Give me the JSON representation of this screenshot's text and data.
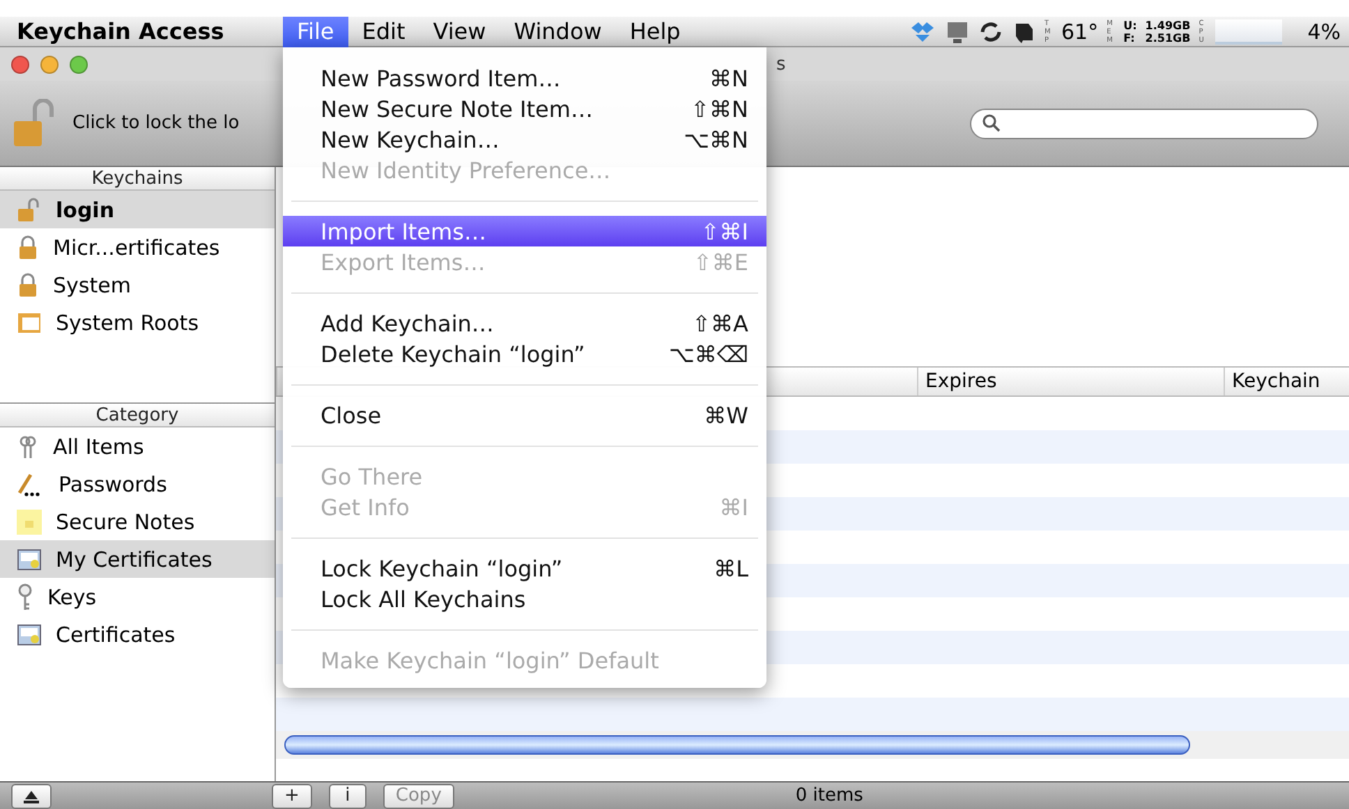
{
  "menu_bar": {
    "app": "Keychain Access",
    "menus": [
      {
        "label": "File",
        "selected": true
      },
      {
        "label": "Edit",
        "selected": false
      },
      {
        "label": "View",
        "selected": false
      },
      {
        "label": "Window",
        "selected": false
      },
      {
        "label": "Help",
        "selected": false
      }
    ],
    "status": {
      "temp_label": "TMP",
      "temp": "61°",
      "mem_label": "MEM",
      "mem_used_label": "U:",
      "mem_used": "1.49GB",
      "mem_free_label": "F:",
      "mem_free": "2.51GB",
      "cpu_label": "CPU",
      "cpu": "4%"
    }
  },
  "window": {
    "title": "s",
    "lock_hint": "Click to lock the lo"
  },
  "sidebar": {
    "keychains_header": "Keychains",
    "keychains": [
      {
        "label": "login",
        "selected": true
      },
      {
        "label": "Micr...ertificates",
        "selected": false
      },
      {
        "label": "System",
        "selected": false
      },
      {
        "label": "System Roots",
        "selected": false
      }
    ],
    "category_header": "Category",
    "categories": [
      {
        "label": "All Items",
        "selected": false
      },
      {
        "label": "Passwords",
        "selected": false
      },
      {
        "label": "Secure Notes",
        "selected": false
      },
      {
        "label": "My Certificates",
        "selected": true
      },
      {
        "label": "Keys",
        "selected": false
      },
      {
        "label": "Certificates",
        "selected": false
      }
    ]
  },
  "table": {
    "columns": [
      "Expires",
      "Keychain"
    ]
  },
  "file_menu": [
    {
      "kind": "item",
      "label": "New Password Item…",
      "shortcut": "⌘N",
      "disabled": false,
      "selected": false
    },
    {
      "kind": "item",
      "label": "New Secure Note Item…",
      "shortcut": "⇧⌘N",
      "disabled": false,
      "selected": false
    },
    {
      "kind": "item",
      "label": "New Keychain…",
      "shortcut": "⌥⌘N",
      "disabled": false,
      "selected": false
    },
    {
      "kind": "item",
      "label": "New Identity Preference…",
      "disabled": true,
      "selected": false
    },
    {
      "kind": "separator"
    },
    {
      "kind": "item",
      "label": "Import Items…",
      "shortcut": "⇧⌘I",
      "disabled": false,
      "selected": true
    },
    {
      "kind": "item",
      "label": "Export Items…",
      "shortcut": "⇧⌘E",
      "disabled": true,
      "selected": false
    },
    {
      "kind": "separator"
    },
    {
      "kind": "item",
      "label": "Add Keychain…",
      "shortcut": "⇧⌘A",
      "disabled": false,
      "selected": false
    },
    {
      "kind": "item",
      "label": "Delete Keychain “login”",
      "shortcut": "⌥⌘⌫",
      "disabled": false,
      "selected": false
    },
    {
      "kind": "separator"
    },
    {
      "kind": "item",
      "label": "Close",
      "shortcut": "⌘W",
      "disabled": false,
      "selected": false
    },
    {
      "kind": "separator"
    },
    {
      "kind": "item",
      "label": "Go There",
      "disabled": true,
      "selected": false
    },
    {
      "kind": "item",
      "label": "Get Info",
      "shortcut": "⌘I",
      "disabled": true,
      "selected": false
    },
    {
      "kind": "separator"
    },
    {
      "kind": "item",
      "label": "Lock Keychain “login”",
      "shortcut": "⌘L",
      "disabled": false,
      "selected": false
    },
    {
      "kind": "item",
      "label": "Lock All Keychains",
      "disabled": false,
      "selected": false
    },
    {
      "kind": "separator"
    },
    {
      "kind": "item",
      "label": "Make Keychain “login” Default",
      "disabled": true,
      "selected": false
    }
  ],
  "bottom_bar": {
    "buttons": [
      {
        "kind": "icon",
        "label": "+"
      },
      {
        "kind": "icon",
        "label": "i"
      },
      {
        "kind": "text",
        "label": "Copy",
        "disabled": true
      }
    ],
    "status": "0 items"
  }
}
